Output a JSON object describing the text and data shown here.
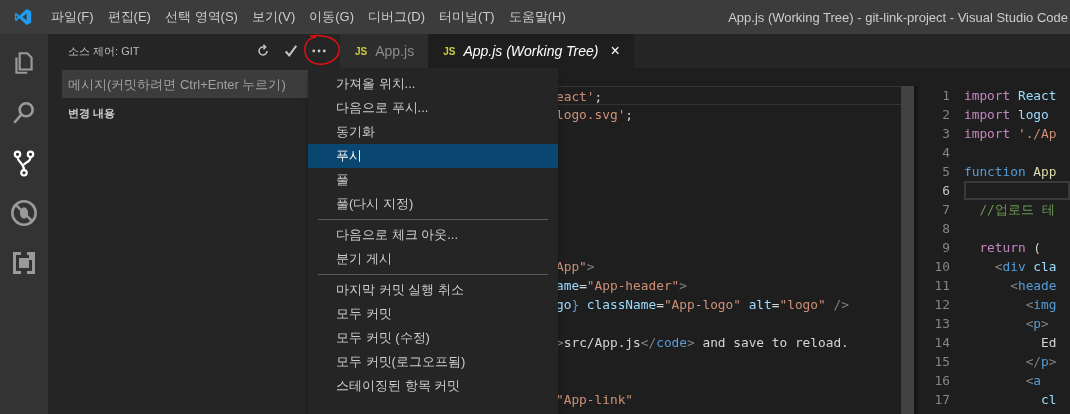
{
  "menu_bar": [
    "파일(F)",
    "편집(E)",
    "선택 영역(S)",
    "보기(V)",
    "이동(G)",
    "디버그(D)",
    "터미널(T)",
    "도움말(H)"
  ],
  "window": {
    "title": "App.js (Working Tree) - git-link-project - Visual Studio Code"
  },
  "activity_bar": [
    {
      "kind": "files",
      "selected": false
    },
    {
      "kind": "search",
      "selected": false
    },
    {
      "kind": "scm",
      "selected": true
    },
    {
      "kind": "debug",
      "selected": false
    },
    {
      "kind": "extensions",
      "selected": false
    }
  ],
  "sidebar": {
    "title": "소스 제어: GIT",
    "commit_message": {
      "placeholder": "메시지(커밋하려면 Ctrl+Enter 누르기)"
    },
    "section": "변경 내용"
  },
  "tabs": [
    {
      "badge": "JS",
      "label": "App.js",
      "selected": false
    },
    {
      "badge": "JS",
      "label": "App.js (Working Tree)",
      "selected": true,
      "close": "×"
    }
  ],
  "context_menu": [
    {
      "kind": "item",
      "label": "가져올 위치...",
      "selected": false
    },
    {
      "kind": "item",
      "label": "다음으로 푸시...",
      "selected": false
    },
    {
      "kind": "item",
      "label": "동기화",
      "selected": false
    },
    {
      "kind": "item",
      "label": "푸시",
      "selected": true
    },
    {
      "kind": "item",
      "label": "풀",
      "selected": false
    },
    {
      "kind": "item",
      "label": "풀(다시 지정)",
      "selected": false
    },
    {
      "kind": "separator"
    },
    {
      "kind": "item",
      "label": "다음으로 체크 아웃...",
      "selected": false
    },
    {
      "kind": "item",
      "label": "분기 게시",
      "selected": false
    },
    {
      "kind": "separator"
    },
    {
      "kind": "item",
      "label": "마지막 커밋 실행 취소",
      "selected": false
    },
    {
      "kind": "item",
      "label": "모두 커밋",
      "selected": false
    },
    {
      "kind": "item",
      "label": "모두 커밋 (수정)",
      "selected": false
    },
    {
      "kind": "item",
      "label": "모두 커밋(로그오프됨)",
      "selected": false
    },
    {
      "kind": "item",
      "label": "스테이징된 항목 커밋",
      "selected": false
    }
  ],
  "original_pane": {
    "lines": [
      {
        "current": true,
        "tokens": [
          {
            "kind": "string",
            "text": "eact'"
          },
          {
            "kind": "plain",
            "text": ";"
          }
        ]
      },
      {
        "current": false,
        "tokens": [
          {
            "kind": "string",
            "text": "logo.svg'"
          },
          {
            "kind": "plain",
            "text": ";"
          }
        ]
      },
      {
        "current": false
      },
      {
        "current": false
      },
      {
        "current": false
      },
      {
        "current": false
      },
      {
        "current": false
      },
      {
        "current": false
      },
      {
        "current": false
      },
      {
        "current": false,
        "tokens": [
          {
            "kind": "string",
            "text": "App\""
          },
          {
            "kind": "tag",
            "text": ">"
          }
        ]
      },
      {
        "current": false,
        "tokens": [
          {
            "kind": "attr",
            "text": "ame"
          },
          {
            "kind": "plain",
            "text": "="
          },
          {
            "kind": "string",
            "text": "\"App-header\""
          },
          {
            "kind": "tag",
            "text": ">"
          }
        ]
      },
      {
        "current": false,
        "tokens": [
          {
            "kind": "attr",
            "text": "go"
          },
          {
            "kind": "keyword",
            "text": "} "
          },
          {
            "kind": "attr",
            "text": "className"
          },
          {
            "kind": "plain",
            "text": "="
          },
          {
            "kind": "string",
            "text": "\"App-logo\" "
          },
          {
            "kind": "attr",
            "text": "alt"
          },
          {
            "kind": "plain",
            "text": "="
          },
          {
            "kind": "string",
            "text": "\"logo\" "
          },
          {
            "kind": "tag",
            "text": "/>"
          }
        ]
      },
      {
        "current": false
      },
      {
        "current": false,
        "tokens": [
          {
            "kind": "tag",
            "text": ">"
          },
          {
            "kind": "plain",
            "text": "src/App.js"
          },
          {
            "kind": "tag",
            "text": "</"
          },
          {
            "kind": "keyword",
            "text": "code"
          },
          {
            "kind": "tag",
            "text": ">"
          },
          {
            "kind": "plain",
            "text": " and save to reload."
          }
        ]
      },
      {
        "current": false
      },
      {
        "current": false
      },
      {
        "current": false,
        "tokens": [
          {
            "kind": "string",
            "text": "\"App-link\""
          }
        ]
      }
    ]
  },
  "modified_pane": {
    "lines": [
      {
        "number": "1",
        "current": false,
        "tokens": [
          {
            "kind": "control",
            "text": "import "
          },
          {
            "kind": "attr",
            "text": "React"
          }
        ]
      },
      {
        "number": "2",
        "current": false,
        "tokens": [
          {
            "kind": "control",
            "text": "import "
          },
          {
            "kind": "attr",
            "text": "logo"
          }
        ]
      },
      {
        "number": "3",
        "current": false,
        "tokens": [
          {
            "kind": "control",
            "text": "import "
          },
          {
            "kind": "string",
            "text": "'./Ap"
          }
        ]
      },
      {
        "number": "4",
        "current": false
      },
      {
        "number": "5",
        "current": false,
        "tokens": [
          {
            "kind": "keyword",
            "text": "function "
          },
          {
            "kind": "function",
            "text": "App"
          }
        ]
      },
      {
        "number": "6",
        "current": true
      },
      {
        "number": "7",
        "current": false,
        "tokens": [
          {
            "kind": "comment",
            "text": "  //업로드 테"
          }
        ]
      },
      {
        "number": "8",
        "current": false
      },
      {
        "number": "9",
        "current": false,
        "tokens": [
          {
            "kind": "control",
            "text": "  return"
          },
          {
            "kind": "plain",
            "text": " ("
          }
        ]
      },
      {
        "number": "10",
        "current": false,
        "tokens": [
          {
            "kind": "tag",
            "text": "    <"
          },
          {
            "kind": "keyword",
            "text": "div "
          },
          {
            "kind": "attr",
            "text": "cla"
          }
        ]
      },
      {
        "number": "11",
        "current": false,
        "tokens": [
          {
            "kind": "tag",
            "text": "      <"
          },
          {
            "kind": "keyword",
            "text": "heade"
          }
        ]
      },
      {
        "number": "12",
        "current": false,
        "tokens": [
          {
            "kind": "tag",
            "text": "        <"
          },
          {
            "kind": "keyword",
            "text": "img"
          }
        ]
      },
      {
        "number": "13",
        "current": false,
        "tokens": [
          {
            "kind": "tag",
            "text": "        <"
          },
          {
            "kind": "keyword",
            "text": "p"
          },
          {
            "kind": "tag",
            "text": ">"
          }
        ]
      },
      {
        "number": "14",
        "current": false,
        "tokens": [
          {
            "kind": "plain",
            "text": "          Ed"
          }
        ]
      },
      {
        "number": "15",
        "current": false,
        "tokens": [
          {
            "kind": "tag",
            "text": "        </"
          },
          {
            "kind": "keyword",
            "text": "p"
          },
          {
            "kind": "tag",
            "text": ">"
          }
        ]
      },
      {
        "number": "16",
        "current": false,
        "tokens": [
          {
            "kind": "tag",
            "text": "        <"
          },
          {
            "kind": "keyword",
            "text": "a"
          }
        ]
      },
      {
        "number": "17",
        "current": false,
        "tokens": [
          {
            "kind": "attr",
            "text": "          cl"
          }
        ]
      }
    ]
  }
}
